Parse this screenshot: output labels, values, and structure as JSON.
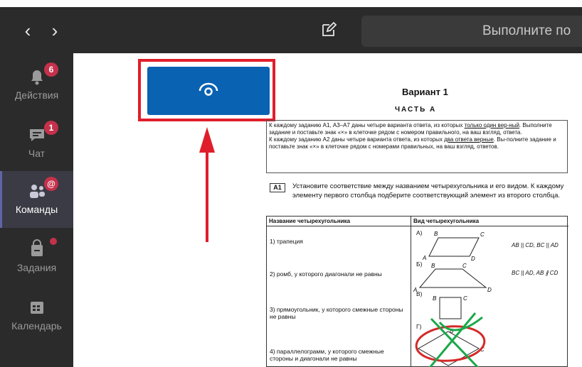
{
  "titlebar": {
    "back_glyph": "‹",
    "forward_glyph": "›",
    "compose_icon": "compose-icon",
    "search_text": "Выполните по"
  },
  "rail": {
    "items": [
      {
        "label": "Действия",
        "icon": "bell-icon",
        "badge": "6"
      },
      {
        "label": "Чат",
        "icon": "chat-icon",
        "badge": "1"
      },
      {
        "label": "Команды",
        "icon": "teams-icon",
        "badge": "@"
      },
      {
        "label": "Задания",
        "icon": "assignments-icon",
        "badge": ""
      },
      {
        "label": "Календарь",
        "icon": "calendar-icon",
        "badge": ""
      }
    ]
  },
  "viewer": {
    "icon": "eye-icon"
  },
  "doc": {
    "variant": "Вариант 1",
    "part": "ЧАСТЬ А",
    "instr1_a": "К каждому заданию А1, А3–А7 даны четыре варианта ответа, из которых ",
    "instr1_u": "только один вер-ный",
    "instr1_b": ". Выполните задание и поставьте знак «×» в клеточке рядом с номером правильного, на ваш взгляд, ответа.",
    "instr2_a": "К каждому заданию А2 даны четыре варианта ответа, из которых ",
    "instr2_u": "два ответа верные",
    "instr2_b": ". Вы-полните задание и поставьте знак «×» в клеточке рядом с номерами правильных, на ваш взгляд, ответов.",
    "question_label": "А1",
    "question_text": "Установите соответствие между названием четырехугольника и его видом. К каждому элементу первого столбца подберите соответствующий элемент из второго столбца.",
    "col1_header": "Название четырехугольника",
    "col2_header": "Вид четырехугольника",
    "rows": [
      "1) трапеция",
      "2) ромб, у которого диагонали не равны",
      "3) прямоугольник, у которого смежные стороны не равны",
      "4) параллелограмм, у которого смежные стороны и диагонали не равны"
    ],
    "options": [
      "А)",
      "Б)",
      "В)",
      "Г)"
    ],
    "relation_a": "AB || CD, BC || AD",
    "relation_b": "BC || AD, AB ∦ CD",
    "vertex_labels": [
      "A",
      "B",
      "C",
      "D"
    ]
  },
  "colors": {
    "chrome": "#2b2b2b",
    "accent": "#0a62b3",
    "badge": "#c4314b",
    "annotation": "#e01e2b",
    "scribble_green": "#1aa84a"
  }
}
